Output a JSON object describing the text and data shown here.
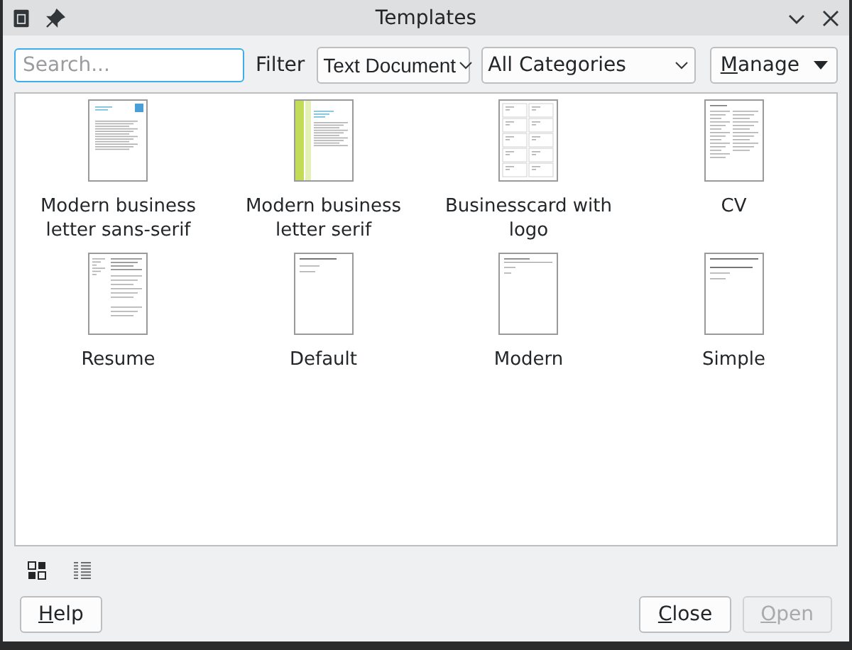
{
  "window": {
    "title": "Templates"
  },
  "search": {
    "placeholder": "Search...",
    "focused": true
  },
  "filter_label": "Filter",
  "dropdowns": [
    {
      "value": "Text Document"
    },
    {
      "value": "All Categories"
    }
  ],
  "manage_button": {
    "label": "Manage"
  },
  "templates": [
    {
      "name": "Modern business letter sans-serif",
      "kind": "letter-sans"
    },
    {
      "name": "Modern business letter serif",
      "kind": "letter-serif"
    },
    {
      "name": "Businesscard with logo",
      "kind": "cards"
    },
    {
      "name": "CV",
      "kind": "cv"
    },
    {
      "name": "Resume",
      "kind": "resume"
    },
    {
      "name": "Default",
      "kind": "default"
    },
    {
      "name": "Modern",
      "kind": "modern"
    },
    {
      "name": "Simple",
      "kind": "simple"
    }
  ],
  "view_modes": [
    {
      "kind": "thumbnails",
      "selected": true
    },
    {
      "kind": "list",
      "selected": false
    }
  ],
  "buttons_left": [
    {
      "label": "Help",
      "disabled": false
    }
  ],
  "buttons_right": [
    {
      "label": "Close",
      "disabled": false
    },
    {
      "label": "Open",
      "disabled": true
    }
  ]
}
